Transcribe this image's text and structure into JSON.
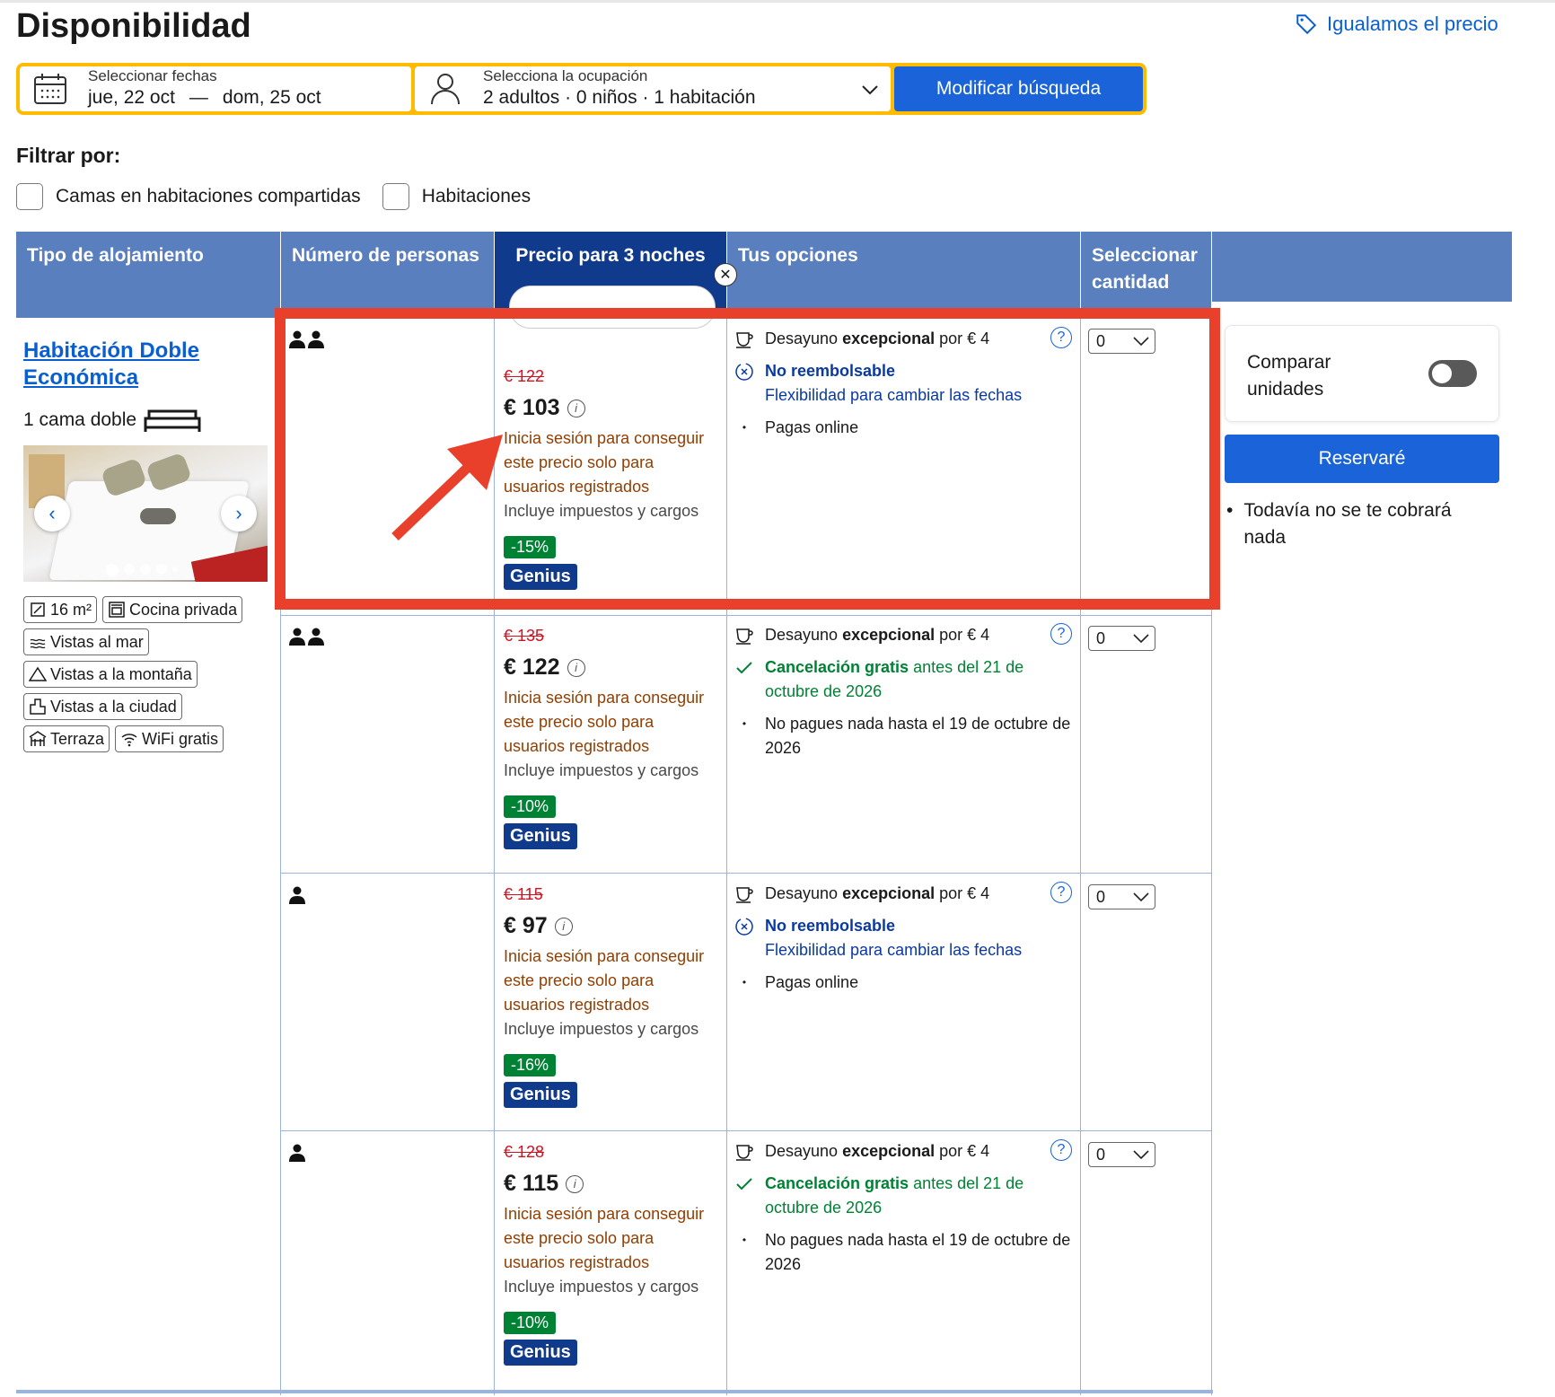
{
  "header": {
    "title": "Disponibilidad",
    "price_match": "Igualamos el precio"
  },
  "search": {
    "dates_label": "Seleccionar fechas",
    "checkin": "jue, 22 oct",
    "dash": "—",
    "checkout": "dom, 25 oct",
    "occupancy_label": "Selecciona la ocupación",
    "occupancy_value": "2 adultos · 0 niños · 1 habitación",
    "button": "Modificar búsqueda"
  },
  "filters": {
    "title": "Filtrar por:",
    "options": [
      "Camas en habitaciones compartidas",
      "Habitaciones"
    ]
  },
  "table": {
    "headers": [
      "Tipo de alojamiento",
      "Número de personas",
      "Precio para 3 noches",
      "Tus opciones",
      "Seleccionar cantidad"
    ]
  },
  "room": {
    "name": "Habitación Doble Económica",
    "bed": "1 cama doble",
    "facilities": [
      "16 m²",
      "Cocina privada",
      "Vistas al mar",
      "Vistas a la montaña",
      "Vistas a la ciudad",
      "Terraza",
      "WiFi gratis"
    ]
  },
  "rows": [
    {
      "persons": 2,
      "old_price": "€ 122",
      "price": "€ 103",
      "login": "Inicia sesión para conseguir este precio solo para usuarios registrados",
      "tax": "Incluye impuestos y cargos",
      "discount": "-15%",
      "genius": "Genius",
      "breakfast_pre": "Desayuno ",
      "breakfast_bold": "excepcional",
      "breakfast_post": " por € 4",
      "policy_bold": "No reembolsable",
      "policy_rest": "",
      "policy_extra": "Flexibilidad para cambiar las fechas",
      "payment": "Pagas online",
      "qty": "0"
    },
    {
      "persons": 2,
      "old_price": "€ 135",
      "price": "€ 122",
      "login": "Inicia sesión para conseguir este precio solo para usuarios registrados",
      "tax": "Incluye impuestos y cargos",
      "discount": "-10%",
      "genius": "Genius",
      "breakfast_pre": "Desayuno ",
      "breakfast_bold": "excepcional",
      "breakfast_post": " por € 4",
      "policy_bold": "Cancelación gratis",
      "policy_rest": " antes del 21 de octubre de 2026",
      "policy_extra": "",
      "payment": "No pagues nada hasta el 19 de octubre de 2026",
      "qty": "0"
    },
    {
      "persons": 1,
      "old_price": "€ 115",
      "price": "€ 97",
      "login": "Inicia sesión para conseguir este precio solo para usuarios registrados",
      "tax": "Incluye impuestos y cargos",
      "discount": "-16%",
      "genius": "Genius",
      "breakfast_pre": "Desayuno ",
      "breakfast_bold": "excepcional",
      "breakfast_post": " por € 4",
      "policy_bold": "No reembolsable",
      "policy_rest": "",
      "policy_extra": "Flexibilidad para cambiar las fechas",
      "payment": "Pagas online",
      "qty": "0"
    },
    {
      "persons": 1,
      "old_price": "€ 128",
      "price": "€ 115",
      "login": "Inicia sesión para conseguir este precio solo para usuarios registrados",
      "tax": "Incluye impuestos y cargos",
      "discount": "-10%",
      "genius": "Genius",
      "breakfast_pre": "Desayuno ",
      "breakfast_bold": "excepcional",
      "breakfast_post": " por € 4",
      "policy_bold": "Cancelación gratis",
      "policy_rest": " antes del 21 de octubre de 2026",
      "policy_extra": "",
      "payment": "No pagues nada hasta el 19 de octubre de 2026",
      "qty": "0"
    }
  ],
  "side": {
    "compare": "Comparar unidades",
    "reserve": "Reservaré",
    "note": "Todavía no se te cobrará nada"
  },
  "colors": {
    "header_blue": "#5a7fbf",
    "header_dark": "#103a8c",
    "accent": "#1a63d8",
    "search_border": "#febb02",
    "annotation_red": "#e8402b"
  }
}
